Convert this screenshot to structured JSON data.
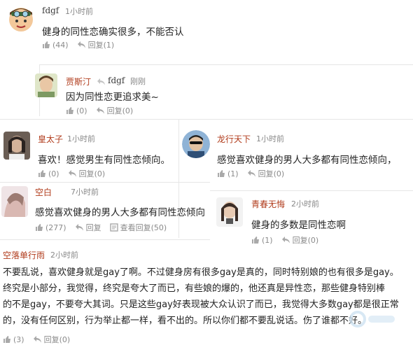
{
  "comments": [
    {
      "user": "fdgf",
      "time": "1小时前",
      "text": "健身的同性恋确实很多，不能否认",
      "likes": "(44)",
      "reply": "回复(1)"
    },
    {
      "user": "贾斯汀",
      "reply_to": "fdgf",
      "time": "刚刚",
      "text": "因为同性恋更追求美~",
      "likes": "(0)",
      "reply": "回复(0)"
    },
    {
      "user": "皇太子",
      "time": "1小时前",
      "text": "喜欢！感觉男生有同性恋倾向。",
      "likes": "(0)",
      "reply": "回复(0)"
    },
    {
      "user": "龙行天下",
      "time": "1小时前",
      "text": "感觉喜欢健身的男人大多都有同性恋倾向，",
      "likes": "(1)",
      "reply": "回复(0)"
    },
    {
      "user": "空白",
      "time": "7小时前",
      "text": "感觉喜欢健身的男人大多都有同性恋倾向",
      "likes": "(277)",
      "reply": "回复",
      "view_replies": "查看回复(50)"
    },
    {
      "user": "青春无悔",
      "time": "2小时前",
      "text": "健身的多数是同性恋啊",
      "likes": "(1)",
      "reply": "回复(0)"
    },
    {
      "user": "空落单行雨",
      "time": "2小时前",
      "lines": [
        "不要乱说，喜欢健身就是gay了啊。不过健身房有很多gay是真的，同时特别娘的也有很多是gay。",
        "终究是小部分，我觉得，终究是夸大了而已，有些娘的爆的，他还真是异性恋，那些健身特别棒",
        "的不是gay，不要夸大其词。只是这些gay好表现被大众认识了而已，我觉得大多数gay都是很正常",
        "的，没有任何区别，行为举止都一样，看不出的。所以你们都不要乱说话。伤了谁都不好。"
      ],
      "likes": "(3)",
      "reply": "回复(0)"
    }
  ],
  "icons": {
    "like": "thumbs-up-icon",
    "reply": "reply-arrow-icon",
    "view": "comment-list-icon"
  },
  "colors": {
    "username": "#b03a1a",
    "meta": "#888888"
  }
}
